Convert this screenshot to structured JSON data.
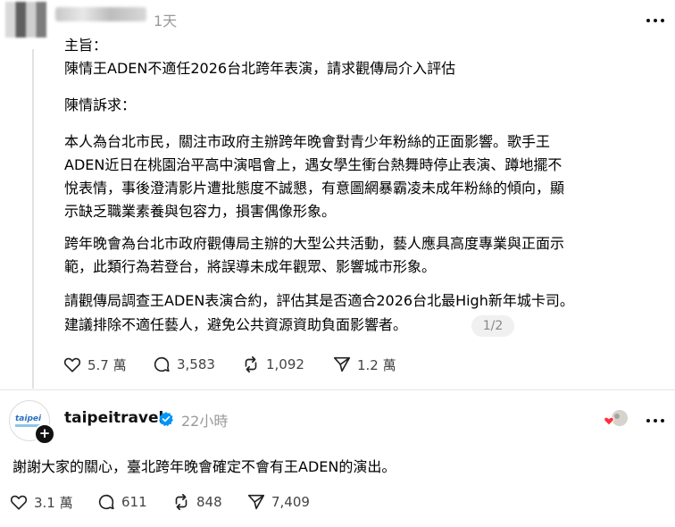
{
  "post1": {
    "time": "1天",
    "lines": [
      "主旨：",
      "陳情王ADEN不適任2026台北跨年表演，請求觀傳局介入評估",
      "陳情訴求：",
      "本人為台北市民，關注市政府主辦跨年晚會對青少年粉絲的正面影響。歌手王",
      "ADEN近日在桃園治平高中演唱會上，遇女學生衝台熱舞時停止表演、蹲地擺不",
      "悅表情，事後澄清影片遭批態度不誠懇，有意圖網暴霸凌未成年粉絲的傾向，顯",
      "示缺乏職業素養與包容力，損害偶像形象。",
      "跨年晚會為台北市政府觀傳局主辦的大型公共活動，藝人應具高度專業與正面示",
      "範，此類行為若登台，將誤導未成年觀眾、影響城市形象。",
      "請觀傳局調查王ADEN表演合約，評估其是否適合2026台北最High新年城卡司。",
      "建議排除不適任藝人，避免公共資源資助負面影響者。"
    ],
    "pager": "1/2",
    "stats": {
      "likes": "5.7 萬",
      "comments": "3,583",
      "reposts": "1,092",
      "shares": "1.2 萬"
    }
  },
  "post2": {
    "avatar_logo": "taipei",
    "username": "taipeitravel",
    "time": "22小時",
    "text": "謝謝大家的關心，臺北跨年晚會確定不會有王ADEN的演出。",
    "stats": {
      "likes": "3.1 萬",
      "comments": "611",
      "reposts": "848",
      "shares": "7,409"
    }
  },
  "icons": {
    "like": "heart-icon",
    "comment": "comment-icon",
    "repost": "repost-icon",
    "share": "share-icon",
    "more": "more-icon",
    "verified": "verified-badge-icon",
    "follow": "plus-icon"
  },
  "colors": {
    "verified": "#0095f6",
    "muted": "#9a9a9a",
    "reactor_heart": "#ff3040"
  }
}
